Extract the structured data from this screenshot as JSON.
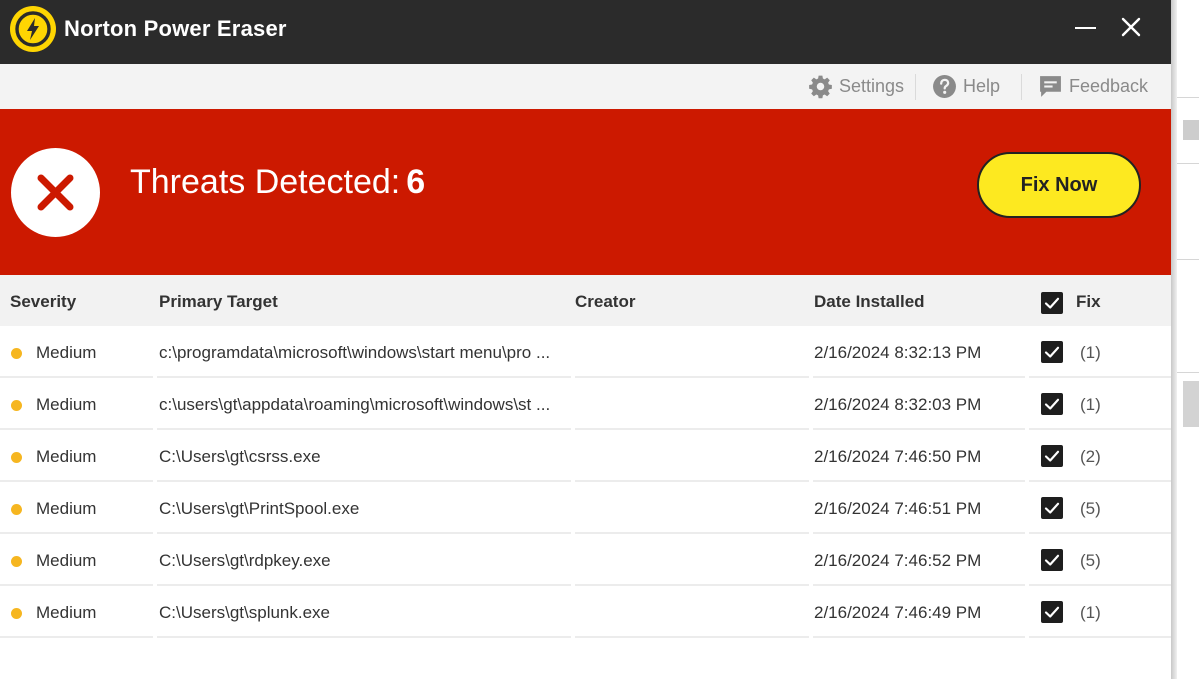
{
  "app": {
    "title": "Norton Power Eraser"
  },
  "window_controls": {
    "minimize": "minimize",
    "close": "close"
  },
  "toolbar": {
    "settings_label": "Settings",
    "help_label": "Help",
    "feedback_label": "Feedback"
  },
  "banner": {
    "label": "Threats Detected:",
    "count": "6",
    "fix_button": "Fix Now",
    "color": "#cc1900",
    "button_color": "#fde920"
  },
  "table": {
    "columns": {
      "severity": "Severity",
      "target": "Primary Target",
      "creator": "Creator",
      "date": "Date Installed",
      "fix": "Fix"
    },
    "select_all_checked": true,
    "rows": [
      {
        "severity": "Medium",
        "target": "c:\\programdata\\microsoft\\windows\\start menu\\pro ...",
        "creator": "",
        "date": "2/16/2024 8:32:13 PM",
        "checked": true,
        "count": "(1)"
      },
      {
        "severity": "Medium",
        "target": "c:\\users\\gt\\appdata\\roaming\\microsoft\\windows\\st ...",
        "creator": "",
        "date": "2/16/2024 8:32:03 PM",
        "checked": true,
        "count": "(1)"
      },
      {
        "severity": "Medium",
        "target": "C:\\Users\\gt\\csrss.exe",
        "creator": "",
        "date": "2/16/2024 7:46:50 PM",
        "checked": true,
        "count": "(2)"
      },
      {
        "severity": "Medium",
        "target": "C:\\Users\\gt\\PrintSpool.exe",
        "creator": "",
        "date": "2/16/2024 7:46:51 PM",
        "checked": true,
        "count": "(5)"
      },
      {
        "severity": "Medium",
        "target": "C:\\Users\\gt\\rdpkey.exe",
        "creator": "",
        "date": "2/16/2024 7:46:52 PM",
        "checked": true,
        "count": "(5)"
      },
      {
        "severity": "Medium",
        "target": "C:\\Users\\gt\\splunk.exe",
        "creator": "",
        "date": "2/16/2024 7:46:49 PM",
        "checked": true,
        "count": "(1)"
      }
    ],
    "severity_color": "#f6b620"
  }
}
